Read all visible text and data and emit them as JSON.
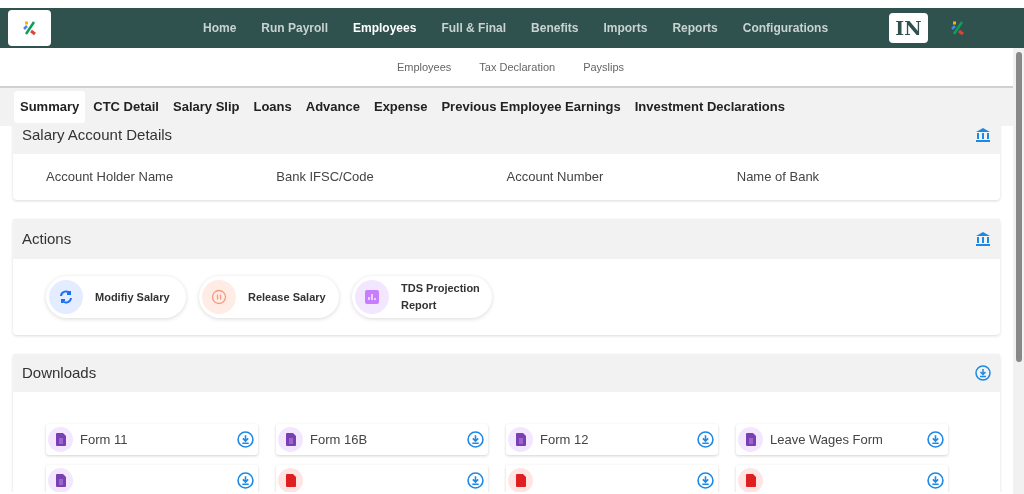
{
  "nav": [
    {
      "label": "Home",
      "selected": false
    },
    {
      "label": "Run Payroll",
      "selected": false
    },
    {
      "label": "Employees",
      "selected": true
    },
    {
      "label": "Full & Final",
      "selected": false
    },
    {
      "label": "Benefits",
      "selected": false
    },
    {
      "label": "Imports",
      "selected": false
    },
    {
      "label": "Reports",
      "selected": false
    },
    {
      "label": "Configurations",
      "selected": false
    }
  ],
  "country_badge": "IN",
  "subnav": [
    "Employees",
    "Tax Declaration",
    "Payslips"
  ],
  "tabs": [
    {
      "label": "Summary",
      "selected": true
    },
    {
      "label": "CTC Detail",
      "selected": false
    },
    {
      "label": "Salary Slip",
      "selected": false
    },
    {
      "label": "Loans",
      "selected": false
    },
    {
      "label": "Advance",
      "selected": false
    },
    {
      "label": "Expense",
      "selected": false
    },
    {
      "label": "Previous Employee Earnings",
      "selected": false
    },
    {
      "label": "Investment Declarations",
      "selected": false
    }
  ],
  "salary_account": {
    "title": "Salary Account Details",
    "fields": [
      "Account Holder Name",
      "Bank IFSC/Code",
      "Account Number",
      "Name of Bank"
    ]
  },
  "actions": {
    "title": "Actions",
    "items": [
      {
        "label": "Modifiy Salary",
        "kind": "modify"
      },
      {
        "label": "Release Salary",
        "kind": "release"
      },
      {
        "label": "TDS Projection Report",
        "kind": "report"
      }
    ]
  },
  "downloads": {
    "title": "Downloads",
    "items": [
      {
        "label": "Form 11",
        "kind": "doc"
      },
      {
        "label": "Form 16B",
        "kind": "doc"
      },
      {
        "label": "Form 12",
        "kind": "doc"
      },
      {
        "label": "Leave Wages Form",
        "kind": "doc"
      },
      {
        "kind": "doc"
      },
      {
        "kind": "pdf"
      },
      {
        "kind": "pdf"
      },
      {
        "kind": "pdf"
      }
    ]
  }
}
